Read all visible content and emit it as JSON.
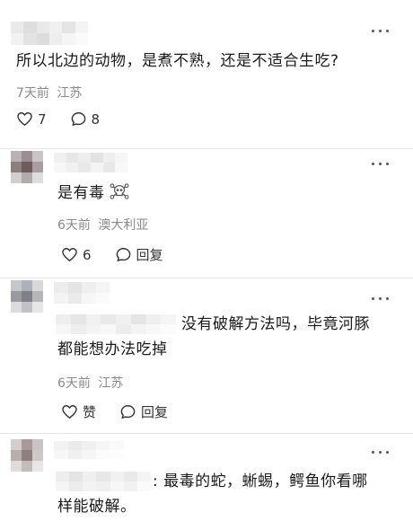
{
  "comments": [
    {
      "text": "所以北边的动物，是煮不熟，还是不适合生吃?",
      "time": "7天前",
      "location": "江苏",
      "like_count": "7",
      "reply_label": "8"
    },
    {
      "text": "是有毒",
      "emoji_icon": "skull-crossbones-icon",
      "time": "6天前",
      "location": "澳大利亚",
      "like_count": "6",
      "reply_label": "回复"
    },
    {
      "text_line1": "没有破解方法吗，毕竟河豚",
      "text_line2": "都能想办法吃掉",
      "time": "6天前",
      "location": "江苏",
      "like_label": "赞",
      "reply_label": "回复"
    },
    {
      "text_line1": ": 最毒的蛇，蜥蜴，鳄鱼你看哪",
      "text_line2": "样能破解。"
    }
  ]
}
